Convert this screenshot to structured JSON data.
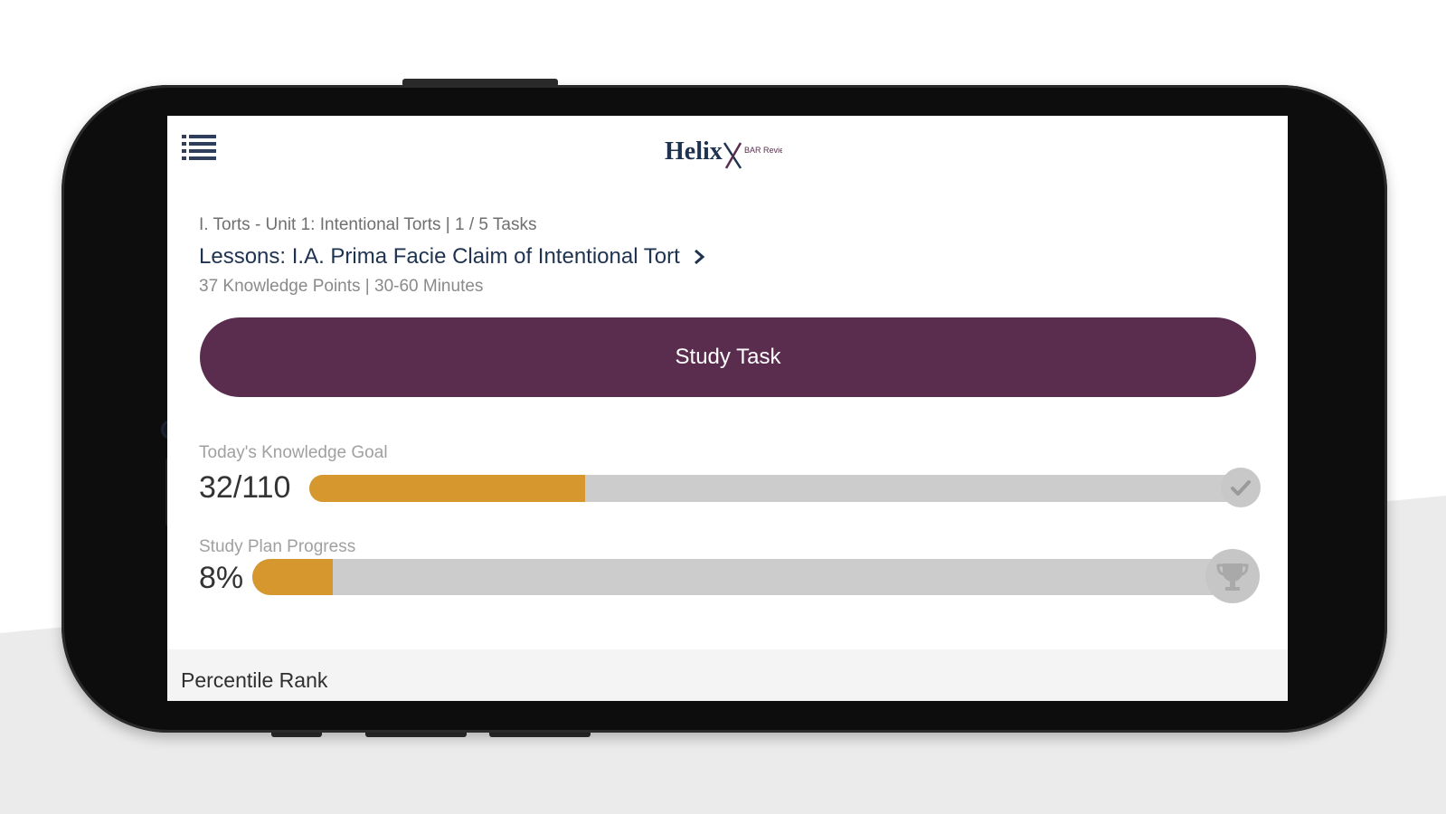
{
  "header": {
    "menu_icon": "list-menu-icon",
    "logo_text": "Helix",
    "logo_subtext": "BAR Review"
  },
  "task": {
    "breadcrumb": "I. Torts - Unit 1: Intentional Torts | 1 / 5 Tasks",
    "title": "Lessons: I.A. Prima Facie Claim of Intentional Tort",
    "title_icon": "chevron-right-icon",
    "meta": "37 Knowledge Points | 30-60 Minutes",
    "study_button_label": "Study Task"
  },
  "knowledge_goal": {
    "label": "Today's Knowledge Goal",
    "value_text": "32/110",
    "current": 32,
    "total": 110,
    "end_icon": "check-icon"
  },
  "study_plan": {
    "label": "Study Plan Progress",
    "value_text": "8%",
    "percent": 8,
    "end_icon": "trophy-icon"
  },
  "percentile": {
    "label": "Percentile Rank"
  },
  "colors": {
    "primary": "#5a2d4f",
    "progress_fill": "#d6972e",
    "track": "#cccccc",
    "title_text": "#1f3350"
  }
}
